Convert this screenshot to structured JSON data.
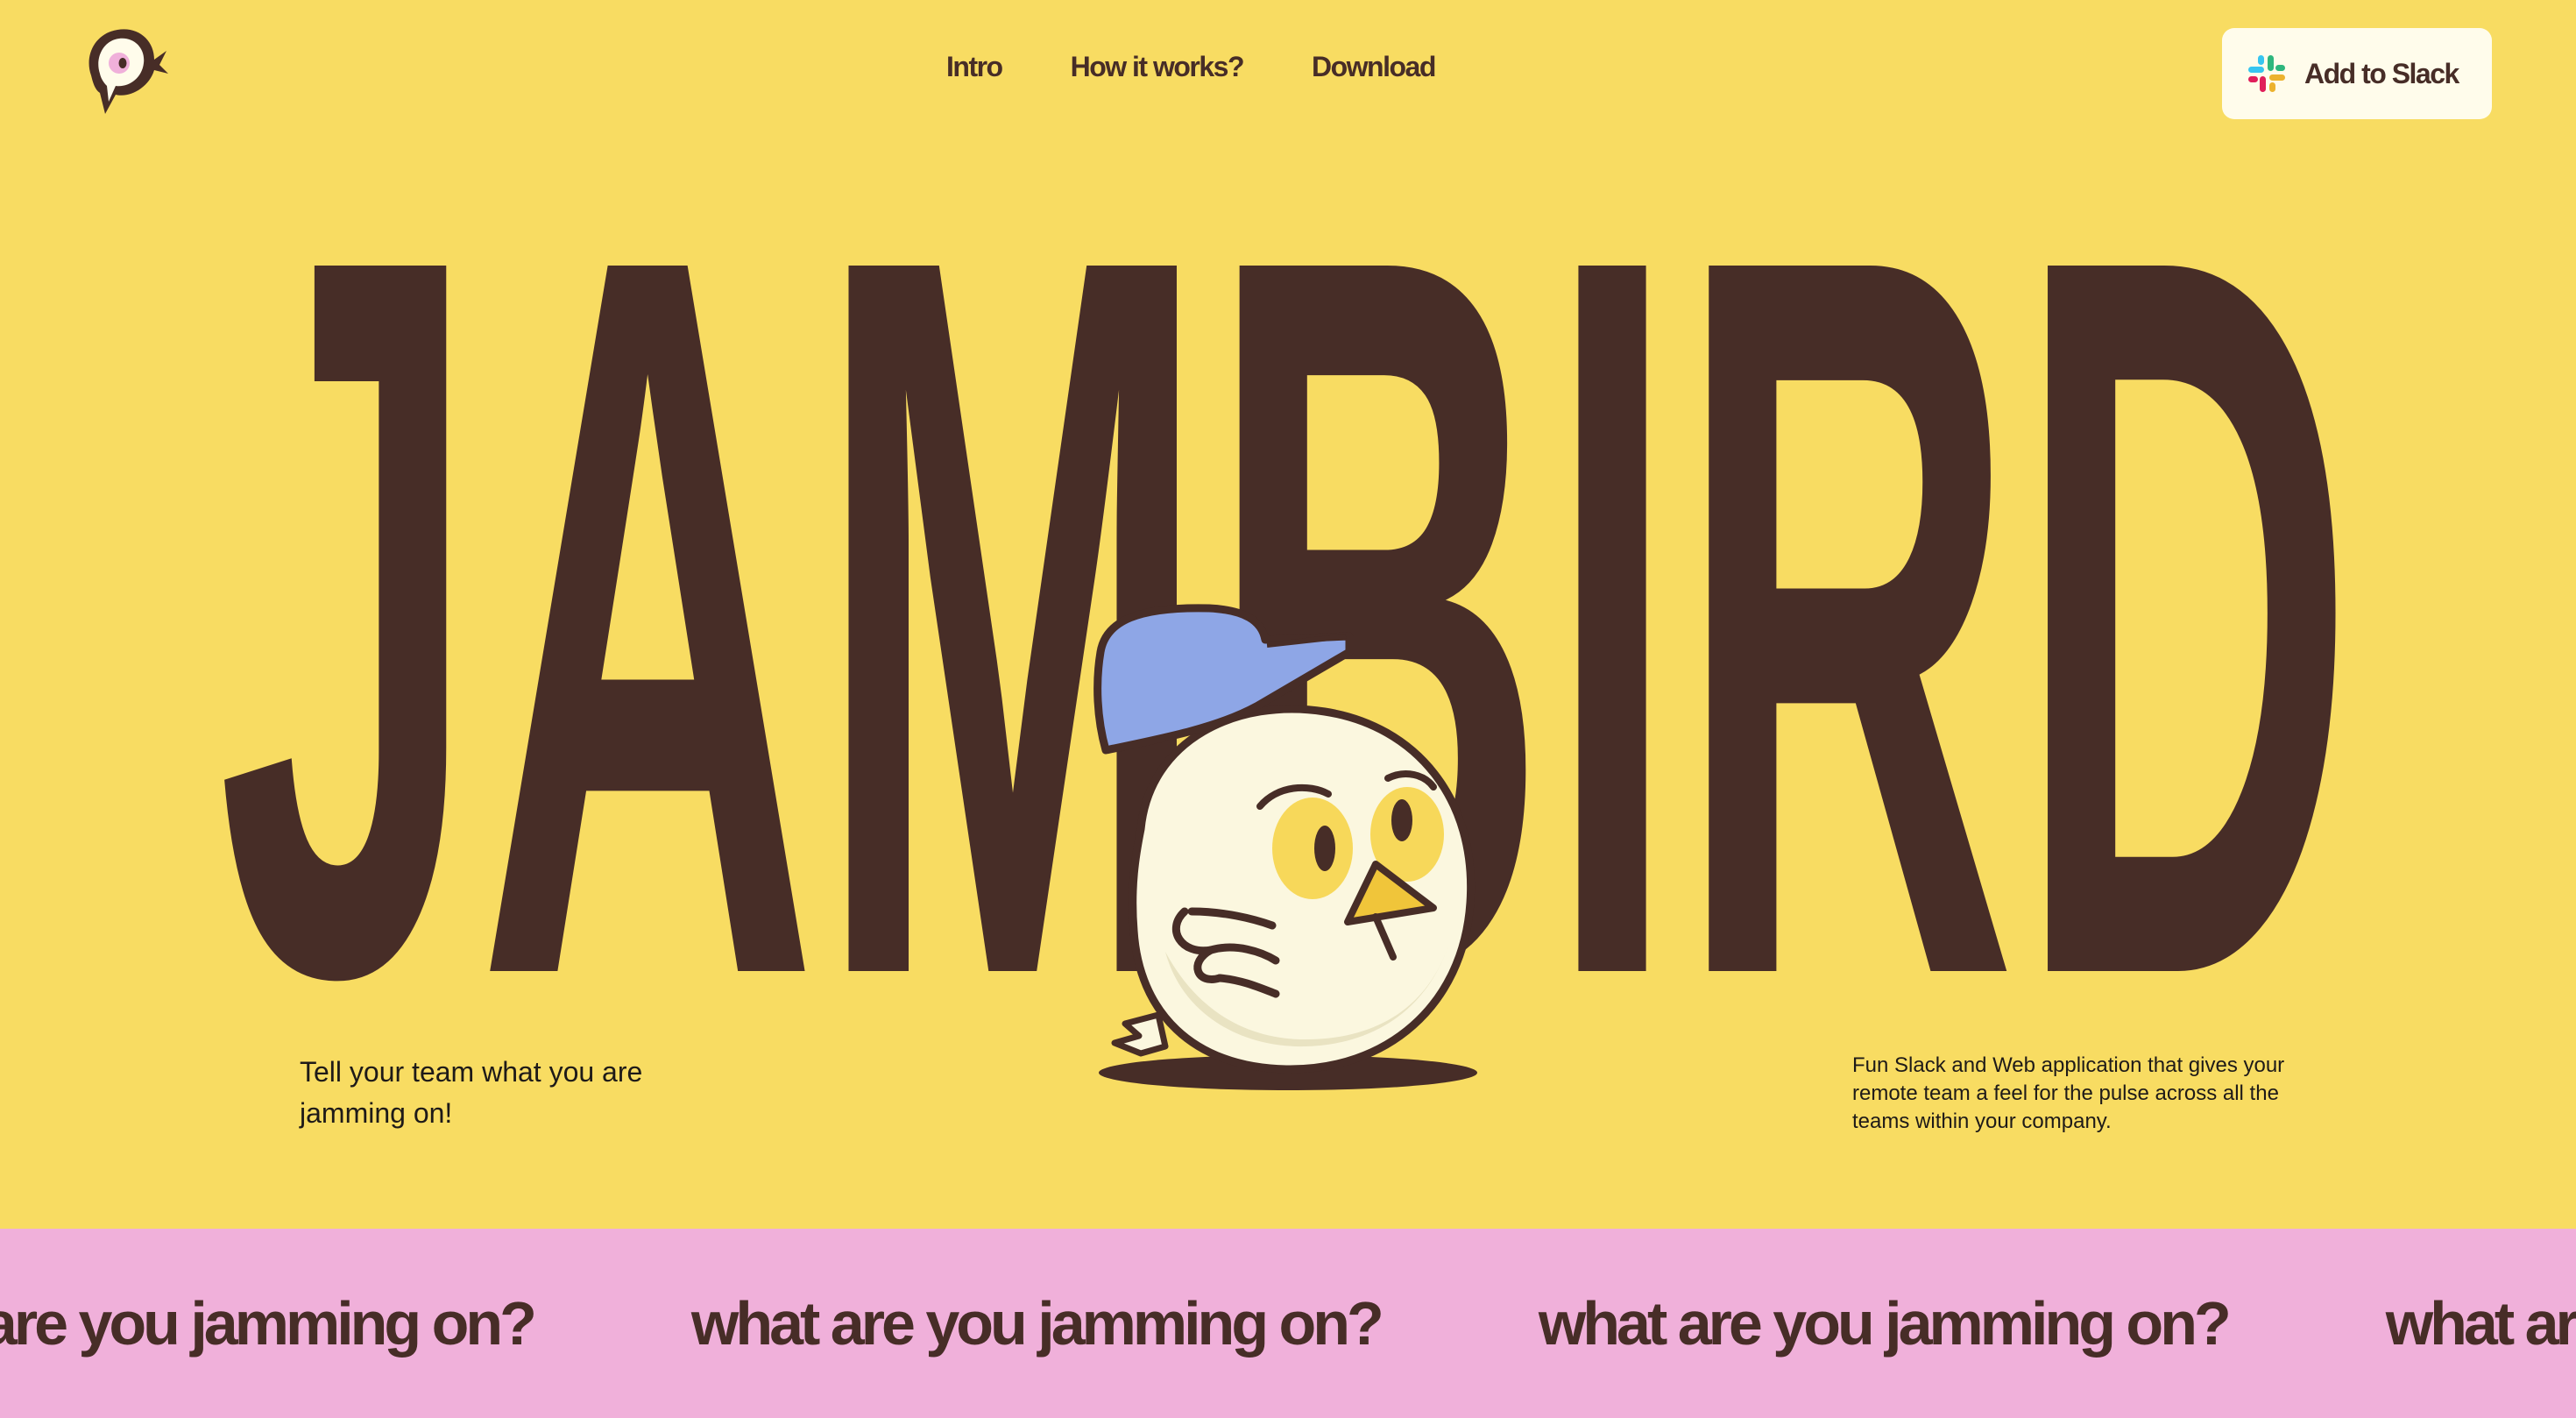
{
  "brand": {
    "logo_icon": "jambird-bird-icon",
    "colors": {
      "background": "#F8DC62",
      "brand_brown": "#472D27",
      "marquee_pink": "#F0B0DA",
      "button_bg": "#FFFCEB",
      "cap_blue": "#8EA6E6"
    }
  },
  "nav": {
    "items": [
      {
        "label": "Intro"
      },
      {
        "label": "How it works?"
      },
      {
        "label": "Download"
      }
    ]
  },
  "header": {
    "cta_label": "Add to Slack",
    "cta_icon": "slack-icon"
  },
  "hero": {
    "title": "JAMBIRD",
    "mascot": "bird-with-cap-illustration",
    "tagline_left": "Tell your team what you are jamming on!",
    "tagline_right": "Fun Slack and Web application that gives your remote team a feel for the pulse across all the teams within your company."
  },
  "marquee": {
    "text": "what are you jamming on?",
    "repeat_items": [
      "what are you jamming on?",
      "what are you jamming on?",
      "what are you jamming on?",
      "what are you jamming on?"
    ]
  }
}
